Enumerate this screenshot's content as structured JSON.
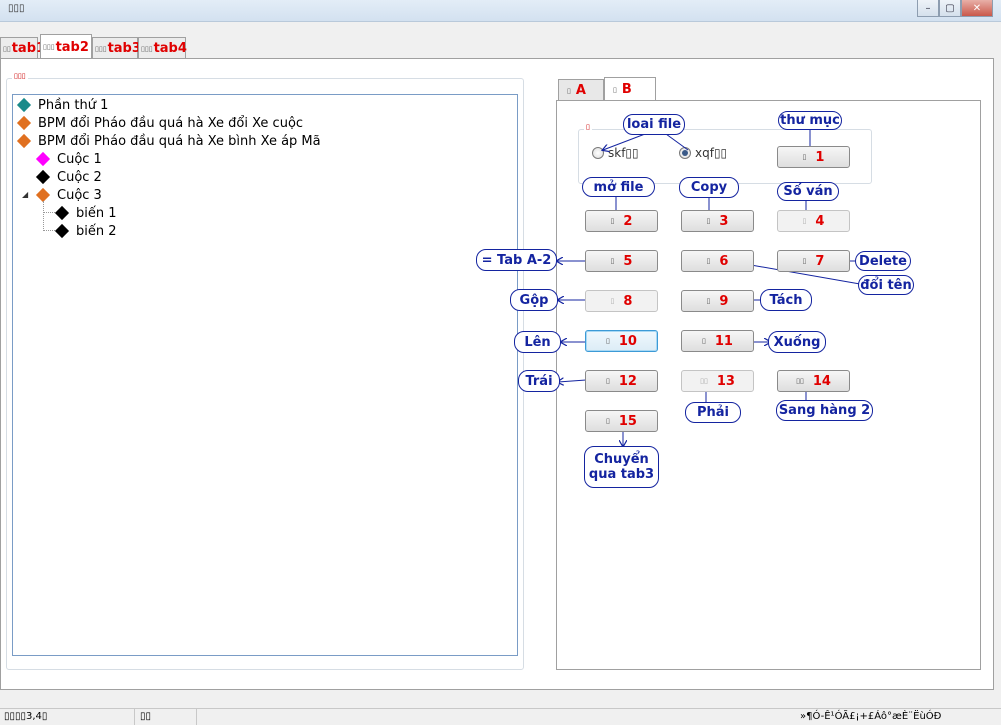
{
  "window": {
    "title": "▯▯▯",
    "controls": [
      "–",
      "▢",
      "✕"
    ]
  },
  "outer_tabs": [
    {
      "glyph": "▯▯",
      "label": "tab1"
    },
    {
      "glyph": "▯▯▯",
      "label": "tab2"
    },
    {
      "glyph": "▯▯▯",
      "label": "tab3"
    },
    {
      "glyph": "▯▯▯",
      "label": "tab4"
    }
  ],
  "tree_group_caption": "▯▯▯",
  "tree": [
    {
      "label": "Phần thứ 1",
      "color": "#1a8a8a"
    },
    {
      "label": "BPM đổi Pháo đầu quá hà Xe đổi Xe cuộc",
      "color": "#e07020"
    },
    {
      "label": "BPM đổi Pháo đầu quá hà Xe bình Xe áp Mã",
      "color": "#e07020"
    },
    {
      "label": "Cuộc 1",
      "color": "#ff00ff"
    },
    {
      "label": "Cuộc 2",
      "color": "#000000"
    },
    {
      "label": "Cuộc 3",
      "color": "#e07020"
    },
    {
      "label": "biến 1",
      "color": "#000000"
    },
    {
      "label": "biến 2",
      "color": "#000000"
    }
  ],
  "inner_tabs": [
    {
      "glyph": "▯",
      "label": "A"
    },
    {
      "glyph": "▯",
      "label": "B"
    }
  ],
  "file_group": {
    "caption": "▯",
    "options": [
      {
        "label": "skf▯▯",
        "checked": false
      },
      {
        "label": "xqf▯▯",
        "checked": true
      }
    ]
  },
  "buttons": [
    {
      "glyph": "▯",
      "number": "1",
      "state": "normal"
    },
    {
      "glyph": "▯",
      "number": "2",
      "state": "normal"
    },
    {
      "glyph": "▯",
      "number": "3",
      "state": "normal"
    },
    {
      "glyph": "▯",
      "number": "4",
      "state": "disabled"
    },
    {
      "glyph": "▯",
      "number": "5",
      "state": "normal"
    },
    {
      "glyph": "▯",
      "number": "6",
      "state": "normal"
    },
    {
      "glyph": "▯",
      "number": "7",
      "state": "normal"
    },
    {
      "glyph": "▯",
      "number": "8",
      "state": "disabled"
    },
    {
      "glyph": "▯",
      "number": "9",
      "state": "normal"
    },
    {
      "glyph": "▯",
      "number": "10",
      "state": "focused"
    },
    {
      "glyph": "▯",
      "number": "11",
      "state": "normal"
    },
    {
      "glyph": "▯",
      "number": "12",
      "state": "normal"
    },
    {
      "glyph": "▯▯",
      "number": "13",
      "state": "disabled"
    },
    {
      "glyph": "▯▯",
      "number": "14",
      "state": "normal"
    },
    {
      "glyph": "▯",
      "number": "15",
      "state": "normal"
    }
  ],
  "callouts": {
    "loai_file": "loai file",
    "thu_muc": "thư mục",
    "mo_file": "mở file",
    "copy": "Copy",
    "so_van": "Số ván",
    "tab_a2": "= Tab A-2",
    "delete": "Delete",
    "doi_ten": "đổi tên",
    "gop": "Gộp",
    "tach": "Tách",
    "len": "Lên",
    "xuong": "Xuống",
    "trai": "Trái",
    "phai": "Phải",
    "sang_hang_2": "Sang hàng 2",
    "chuyen_line1": "Chuyển",
    "chuyen_line2": "qua tab3"
  },
  "status": {
    "left": "▯▯▯▯3,4▯",
    "middle": "▯▯",
    "right": "»¶Ó-Ê¹ÓÃ£¡+£Áô°æÈ¨ËùÓÐ"
  },
  "colors": {
    "accent_red": "#e00000",
    "callout_blue": "#1424a0"
  }
}
